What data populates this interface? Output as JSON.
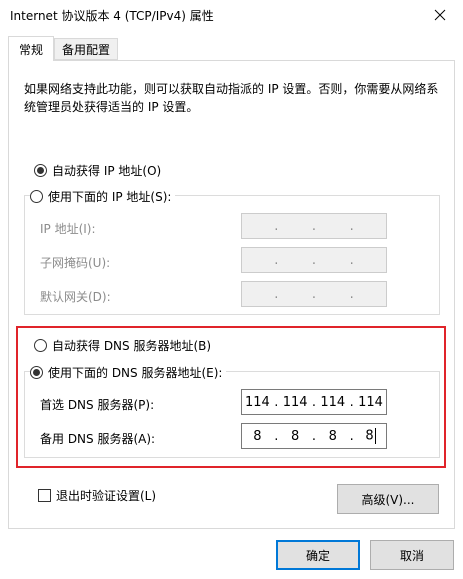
{
  "window": {
    "title": "Internet 协议版本 4 (TCP/IPv4) 属性",
    "close_icon": "close-icon"
  },
  "tabs": [
    {
      "label": "常规",
      "active": true
    },
    {
      "label": "备用配置",
      "active": false
    }
  ],
  "description": "如果网络支持此功能，则可以获取自动指派的 IP 设置。否则，你需要从网络系统管理员处获得适当的 IP 设置。",
  "ip_section": {
    "auto_label": "自动获得 IP 地址(O)",
    "manual_label": "使用下面的 IP 地址(S):",
    "auto_selected": true,
    "fields": [
      {
        "label": "IP 地址(I):",
        "value": [
          "",
          "",
          "",
          ""
        ]
      },
      {
        "label": "子网掩码(U):",
        "value": [
          "",
          "",
          "",
          ""
        ]
      },
      {
        "label": "默认网关(D):",
        "value": [
          "",
          "",
          "",
          ""
        ]
      }
    ]
  },
  "dns_section": {
    "auto_label": "自动获得 DNS 服务器地址(B)",
    "manual_label": "使用下面的 DNS 服务器地址(E):",
    "manual_selected": true,
    "preferred": {
      "label": "首选 DNS 服务器(P):",
      "value": [
        "114",
        "114",
        "114",
        "114"
      ]
    },
    "alternate": {
      "label": "备用 DNS 服务器(A):",
      "value": [
        "8",
        "8",
        "8",
        "8"
      ]
    }
  },
  "validate_on_exit": {
    "label": "退出时验证设置(L)",
    "checked": false
  },
  "buttons": {
    "advanced": "高级(V)...",
    "ok": "确定",
    "cancel": "取消"
  },
  "colors": {
    "highlight_frame": "#e0242a",
    "default_button_border": "#0078d7"
  }
}
